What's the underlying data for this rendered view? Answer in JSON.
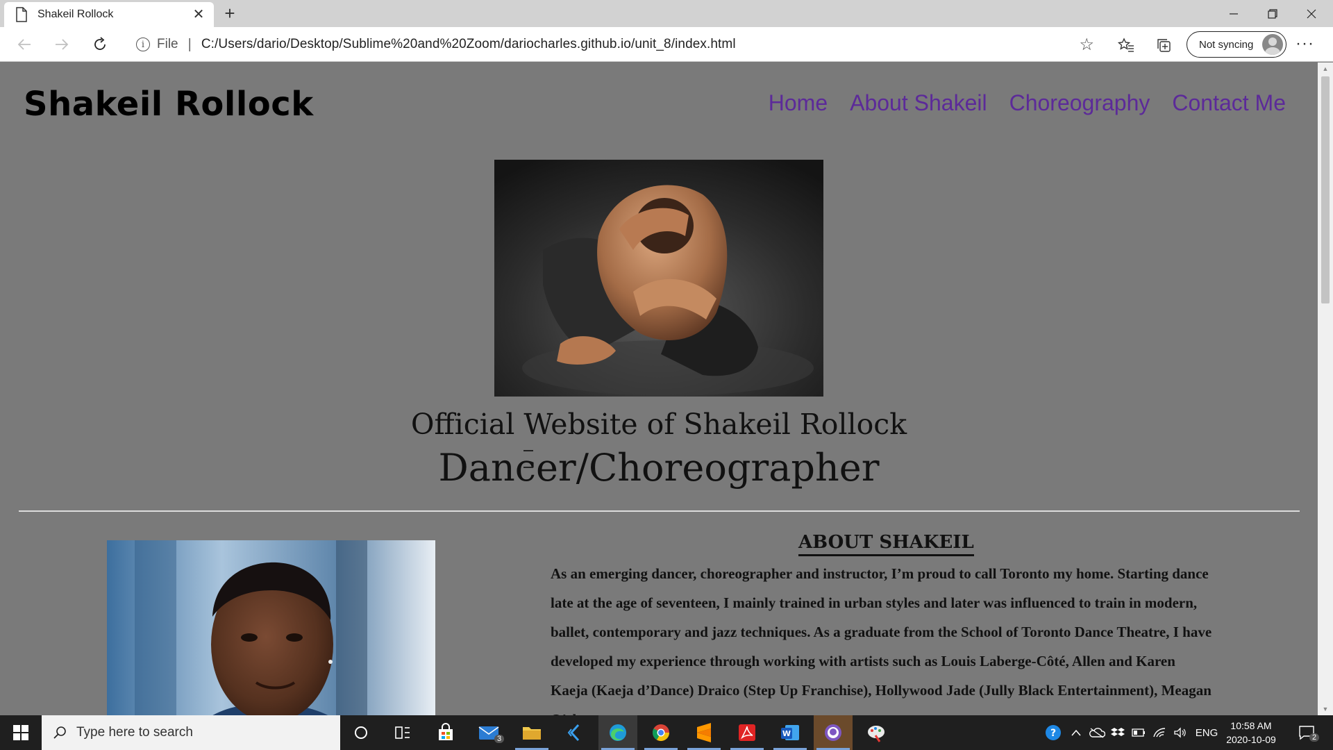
{
  "browser": {
    "tab_title": "Shakeil Rollock",
    "scheme_label": "File",
    "separator": "|",
    "url": "C:/Users/dario/Desktop/Sublime%20and%20Zoom/dariocharles.github.io/unit_8/index.html",
    "sync_label": "Not syncing"
  },
  "site": {
    "name": "Shakeil Rollock",
    "nav": [
      "Home",
      "About Shakeil",
      "Choreography",
      "Contact Me"
    ],
    "hero_title": "Official Website of Shakeil Rollock",
    "hero_subtitle": "Dancer/Choreographer",
    "about_heading": "ABOUT SHAKEIL",
    "about_text": "As an emerging dancer, choreographer and instructor, Iʼm proud to call Toronto my home. Starting dance late at the age of seventeen, I mainly trained in urban styles and later was influenced to train in modern, ballet, contemporary and jazz techniques. As a graduate from the School of Toronto Dance Theatre, I have developed my experience through working with artists such as Louis Laberge-Côté, Allen and Karen Kaeja (Kaeja dʼDance) Draico (Step Up Franchise), Hollywood Jade (Jully Black Entertainment), Meagan Oʼshea"
  },
  "taskbar": {
    "search_placeholder": "Type here to search",
    "mail_badge": "3",
    "language": "ENG",
    "time": "10:58 AM",
    "date": "2020-10-09",
    "notification_count": "2"
  },
  "colors": {
    "page_bg": "#7a7a7a",
    "nav_link": "#5c2a99",
    "taskbar": "#1f1f1f"
  }
}
